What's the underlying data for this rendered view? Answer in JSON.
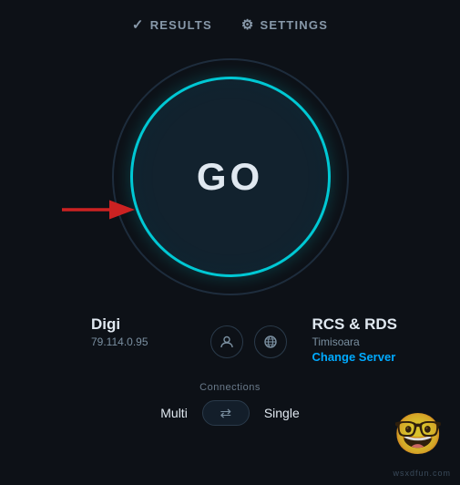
{
  "nav": {
    "results_label": "RESULTS",
    "settings_label": "SETTINGS"
  },
  "main": {
    "go_button_label": "GO"
  },
  "info": {
    "isp_name": "Digi",
    "ip_address": "79.114.0.95",
    "server_name": "RCS & RDS",
    "server_location": "Timisoara",
    "change_server_label": "Change Server"
  },
  "connections": {
    "label": "Connections",
    "multi_label": "Multi",
    "single_label": "Single"
  },
  "watermark": "wsxdfun.com",
  "colors": {
    "accent_cyan": "#00c8d4",
    "accent_blue": "#00aaff",
    "bg": "#0d1117"
  }
}
